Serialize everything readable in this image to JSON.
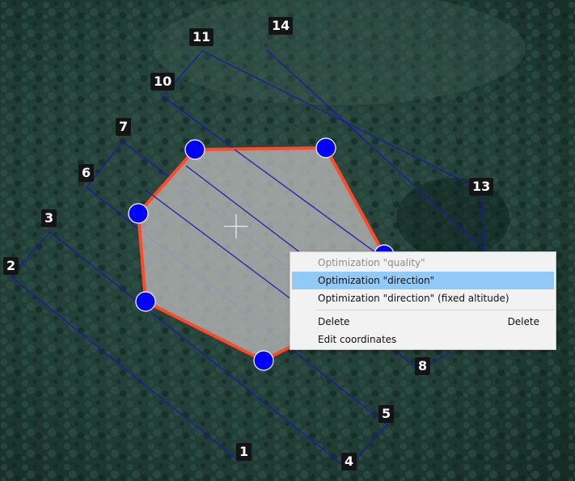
{
  "colors": {
    "polygon_outline": "#ff4a2a",
    "polygon_fill": "#b8b8b8",
    "vertex_handle": "#0000ff",
    "flight_path": "#1a1aa8",
    "label_background": "#141414",
    "menu_highlight": "#91c9f7"
  },
  "waypoint_labels": [
    "1",
    "2",
    "3",
    "4",
    "5",
    "6",
    "7",
    "8",
    "10",
    "11",
    "13",
    "14"
  ],
  "context_menu": {
    "items": [
      {
        "label": "Optimization \"quality\"",
        "state": "disabled"
      },
      {
        "label": "Optimization \"direction\"",
        "state": "highlighted"
      },
      {
        "label": "Optimization \"direction\" (fixed altitude)",
        "state": "normal"
      },
      {
        "label": "Delete",
        "shortcut": "Delete",
        "state": "normal"
      },
      {
        "label": "Edit coordinates",
        "state": "normal"
      }
    ]
  },
  "icons": {
    "cursor": "crosshair-cursor-icon",
    "vertex": "vertex-handle-icon"
  }
}
